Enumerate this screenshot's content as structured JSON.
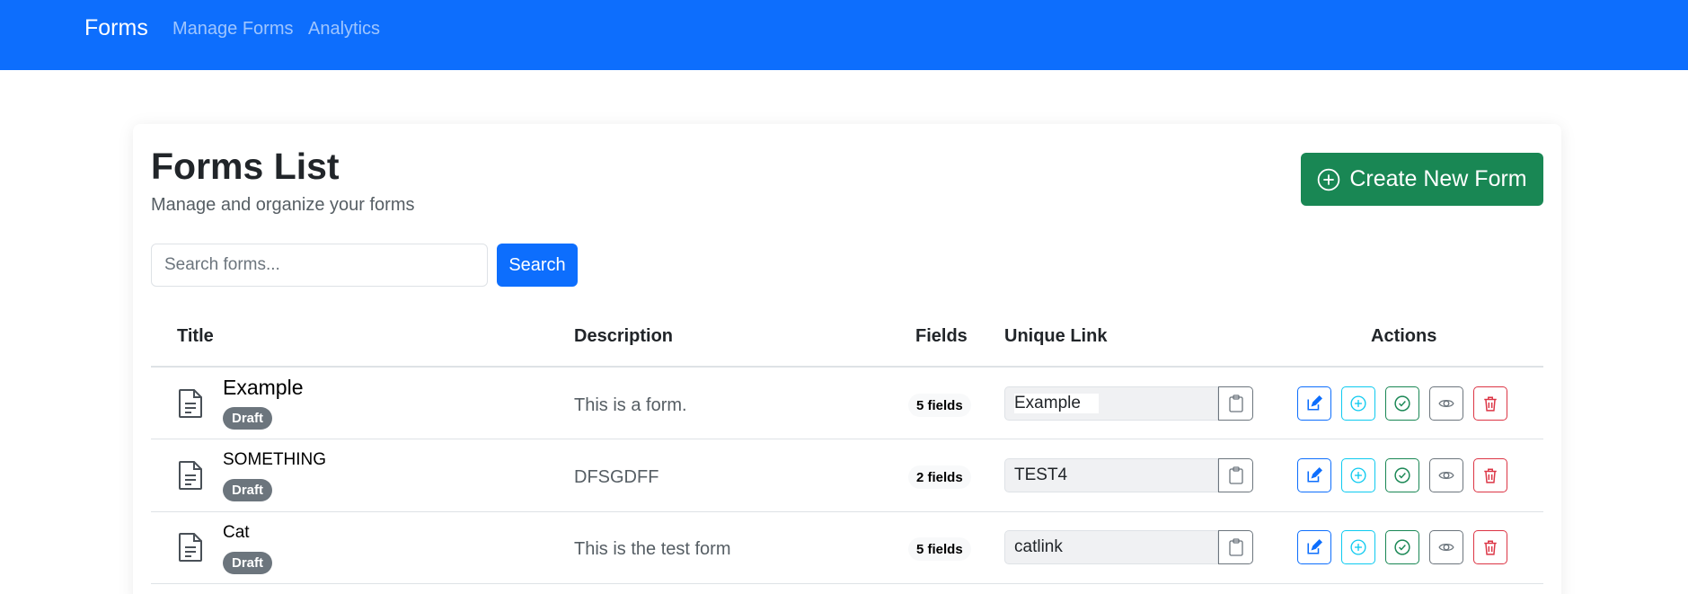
{
  "navbar": {
    "brand": "Forms",
    "links": [
      "Manage Forms",
      "Analytics"
    ],
    "color": "#0d6efd"
  },
  "header": {
    "title": "Forms List",
    "subtitle": "Manage and organize your forms",
    "create_button_label": "Create New Form",
    "create_button_color": "#198754"
  },
  "search": {
    "placeholder": "Search forms...",
    "value": "",
    "button_label": "Search"
  },
  "table": {
    "columns": [
      "Title",
      "Description",
      "Fields",
      "Unique Link",
      "Actions"
    ],
    "rows": [
      {
        "title": "Example",
        "status": "Draft",
        "description": "This is a form.",
        "fields": "5 fields",
        "link": "Example"
      },
      {
        "title": "SOMETHING",
        "status": "Draft",
        "description": "DFSGDFF",
        "fields": "2 fields",
        "link": "TEST4"
      },
      {
        "title": "Cat",
        "status": "Draft",
        "description": "This is the test form",
        "fields": "5 fields",
        "link": "catlink"
      }
    ],
    "action_icons": [
      "edit-icon",
      "plus-circle-icon",
      "check-circle-icon",
      "eye-icon",
      "trash-icon"
    ]
  }
}
